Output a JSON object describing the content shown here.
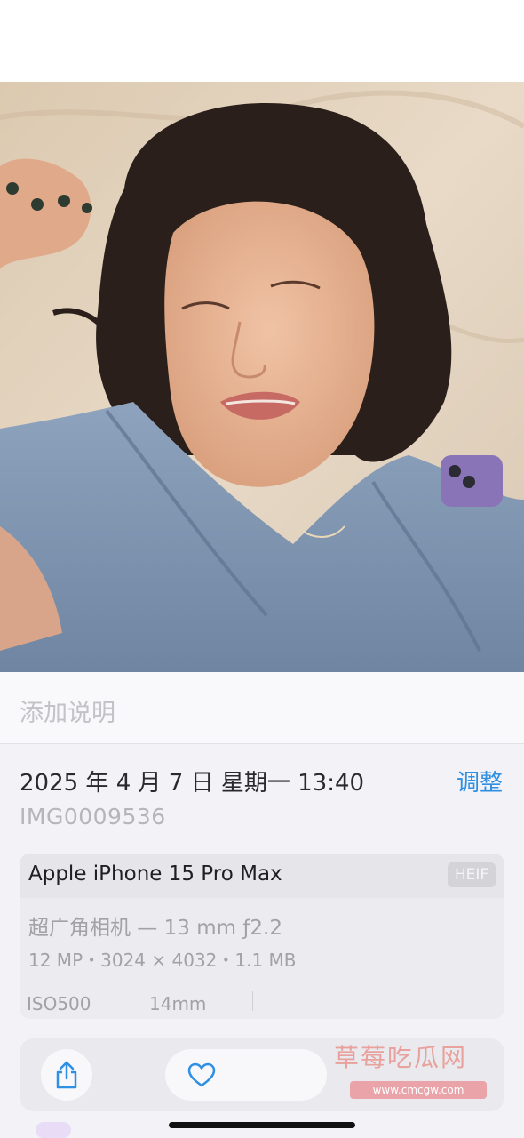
{
  "photo": {
    "description_icon": "portrait-photo"
  },
  "caption": {
    "placeholder": "添加说明"
  },
  "info": {
    "datetime": "2025 年 4 月 7 日 星期一 13:40",
    "adjust_label": "调整",
    "filename": "IMG0009536"
  },
  "camera": {
    "device": "Apple iPhone 15 Pro Max",
    "format_badge": "HEIF",
    "lens": "超广角相机 — 13 mm ƒ2.2",
    "specs": "12 MP・3024 × 4032・1.1 MB",
    "iso": "ISO500",
    "focal_length": "14mm"
  },
  "toolbar": {
    "share_icon": "share-icon",
    "like_icon": "heart-icon"
  },
  "watermark": {
    "title": "草莓吃瓜网",
    "url": "www.cmcgw.com"
  },
  "colors": {
    "accent": "#2f8fe3",
    "sheet_bg": "#f2f2f7"
  }
}
